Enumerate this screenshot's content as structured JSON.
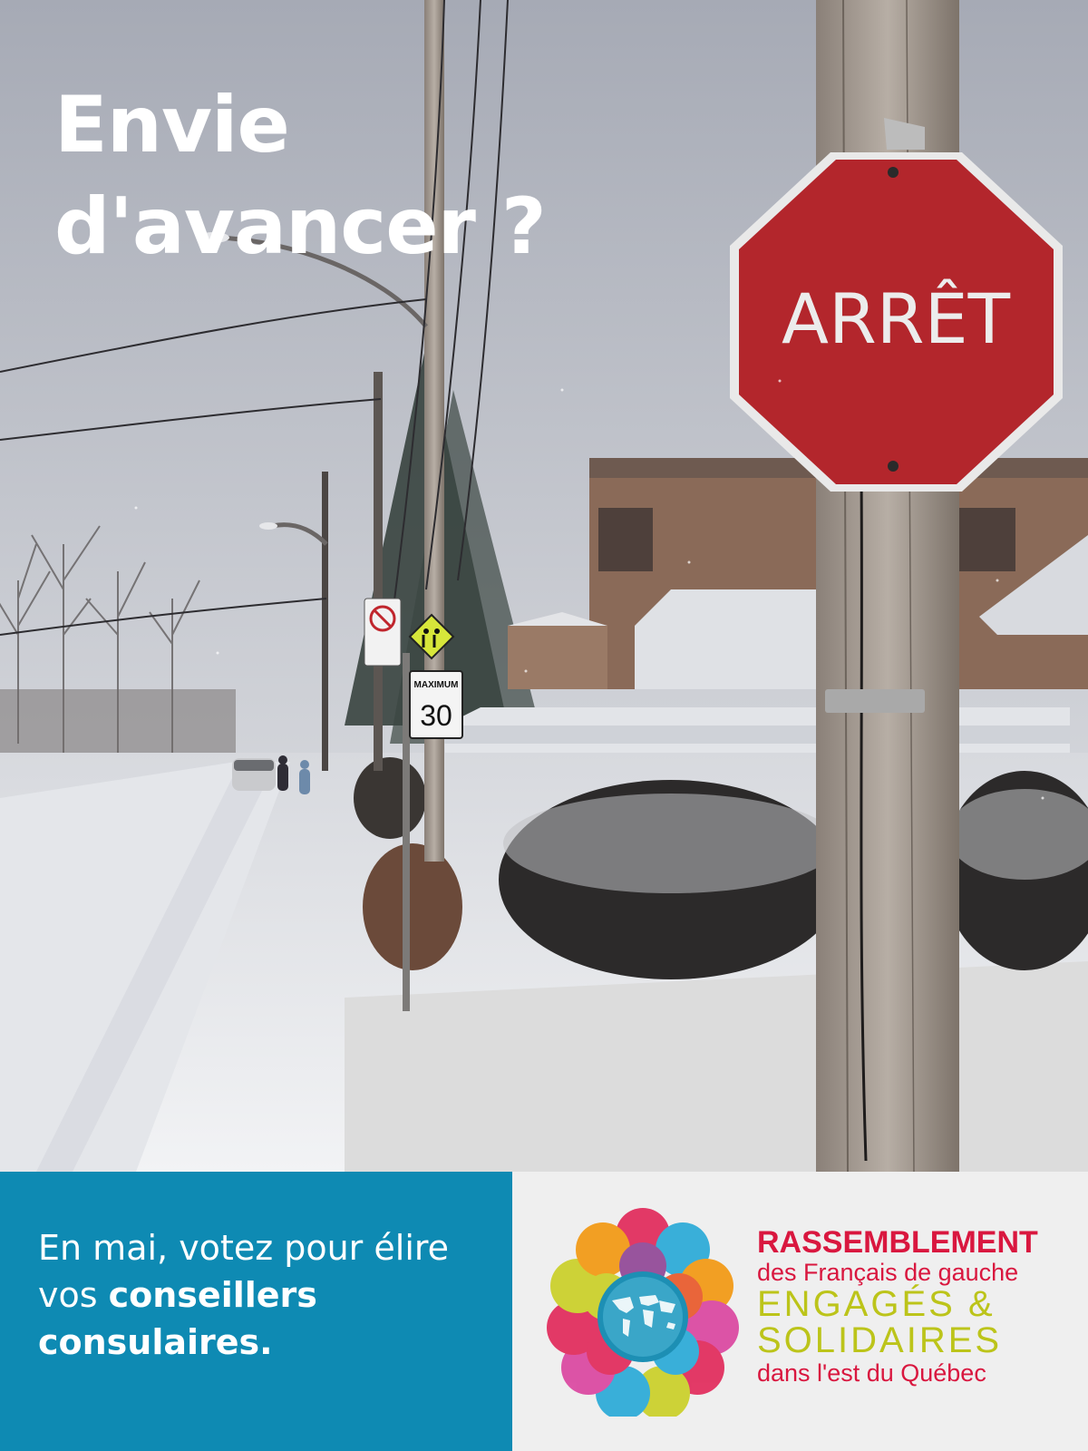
{
  "headline": {
    "line1": "Envie",
    "line2": "d'avancer ?"
  },
  "signs": {
    "stop_text": "ARRÊT",
    "speed_label": "MAXIMUM",
    "speed_value": "30"
  },
  "cta": {
    "part1": "En mai, votez pour élire vos ",
    "emphasis1": "conseillers",
    "space": " ",
    "emphasis2": "consulaires."
  },
  "organization": {
    "line1": "RASSEMBLEMENT",
    "line2": "des Français de gauche",
    "line3": "ENGAGÉS &",
    "line4": "SOLIDAIRES",
    "line5": "dans l'est du Québec"
  },
  "colors": {
    "blue_panel": "#0e8ab3",
    "grey_panel": "#efefef",
    "brand_red": "#d9173f",
    "brand_lime": "#bcc41a",
    "stop_red": "#b3262c"
  }
}
